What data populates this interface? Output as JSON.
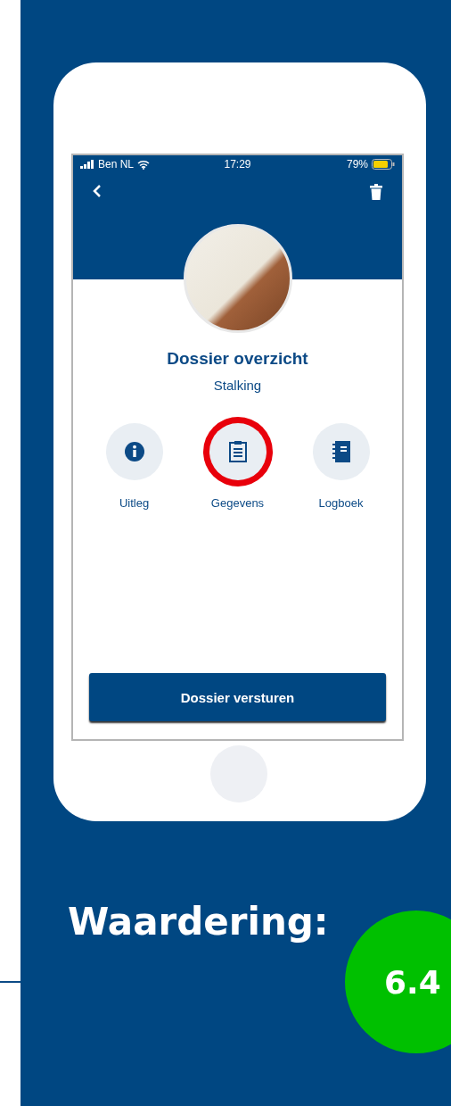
{
  "status_bar": {
    "carrier": "Ben NL",
    "time": "17:29",
    "battery": "79%"
  },
  "header": {
    "title": "Dossier overzicht",
    "subtitle": "Stalking"
  },
  "actions": [
    {
      "label": "Uitleg",
      "kind": "info",
      "highlighted": false
    },
    {
      "label": "Gegevens",
      "kind": "clipboard",
      "highlighted": true
    },
    {
      "label": "Logboek",
      "kind": "notebook",
      "highlighted": false
    }
  ],
  "primary_button": "Dossier versturen",
  "rating": {
    "label": "Waardering:",
    "score": "6.4",
    "color": "#00c000"
  }
}
